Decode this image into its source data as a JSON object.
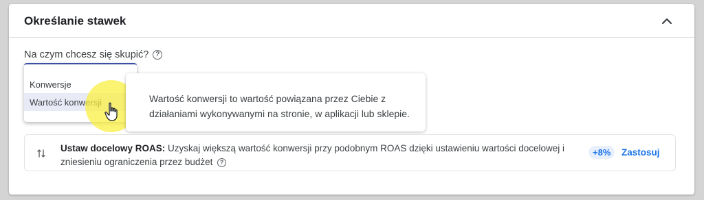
{
  "section": {
    "title": "Określanie stawek"
  },
  "question": {
    "label": "Na czym chcesz się skupić?",
    "help_symbol": "?"
  },
  "dropdown": {
    "options": [
      "Konwersje",
      "Wartość konwersji"
    ]
  },
  "tooltip": {
    "text": "Wartość konwersji to wartość powiązana przez Ciebie z działaniami wykonywanymi na stronie, w aplikacji lub sklepie."
  },
  "recommendation": {
    "title": "Ustaw docelowy ROAS:",
    "body": "Uzyskaj większą wartość konwersji przy podobnym ROAS dzięki ustawieniu wartości docelowej i zniesieniu ograniczenia przez budżet",
    "help_symbol": "?",
    "uplift": "+8%",
    "apply_label": "Zastosuj"
  },
  "colors": {
    "accent_blue": "#1a73e8",
    "selected_bg": "#e8eaf6",
    "cursor_highlight": "#f9ee3c",
    "text_primary": "#202124"
  },
  "icons": {
    "collapse": "chevron-up-icon",
    "help": "help-circle-icon",
    "recommendation": "swap-vertical-icon",
    "cursor": "hand-pointer-icon"
  }
}
